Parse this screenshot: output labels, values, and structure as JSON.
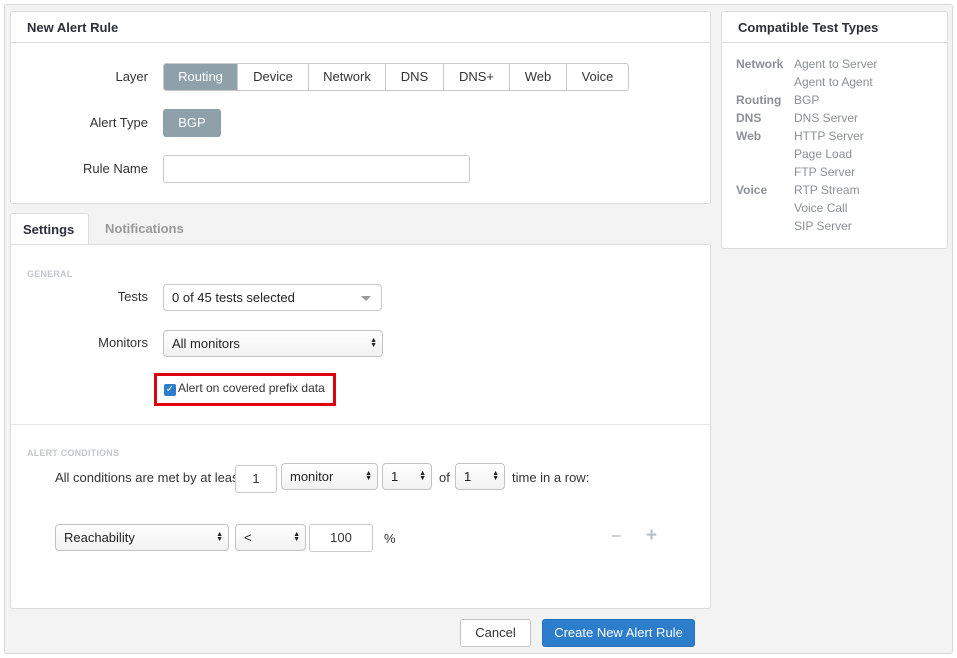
{
  "panel": {
    "title": "New Alert Rule"
  },
  "form": {
    "layer_label": "Layer",
    "layers": [
      "Routing",
      "Device",
      "Network",
      "DNS",
      "DNS+",
      "Web",
      "Voice"
    ],
    "alert_type_label": "Alert Type",
    "alert_type_value": "BGP",
    "rule_name_label": "Rule Name",
    "rule_name_value": ""
  },
  "tabs": {
    "settings": "Settings",
    "notifications": "Notifications"
  },
  "general": {
    "header": "GENERAL",
    "tests_label": "Tests",
    "tests_value": "0 of 45 tests selected",
    "monitors_label": "Monitors",
    "monitors_value": "All monitors",
    "covered_prefix_label": "Alert on covered prefix data",
    "covered_prefix_checked": true
  },
  "conditions": {
    "header": "ALERT CONDITIONS",
    "intro": "All conditions are met by at least",
    "count_value": "1",
    "unit_value": "monitor",
    "times_value": "1",
    "of_text": "of",
    "of_value": "1",
    "row_text": "time in a row:",
    "metric_value": "Reachability",
    "operator_value": "<",
    "threshold_value": "100",
    "unit_suffix": "%",
    "remove_symbol": "−",
    "add_symbol": "+"
  },
  "footer": {
    "cancel_label": "Cancel",
    "create_label": "Create New Alert Rule"
  },
  "compatible": {
    "title": "Compatible Test Types",
    "groups": [
      {
        "category": "Network",
        "items": [
          "Agent to Server",
          "Agent to Agent"
        ]
      },
      {
        "category": "Routing",
        "items": [
          "BGP"
        ]
      },
      {
        "category": "DNS",
        "items": [
          "DNS Server"
        ]
      },
      {
        "category": "Web",
        "items": [
          "HTTP Server",
          "Page Load",
          "FTP Server"
        ]
      },
      {
        "category": "Voice",
        "items": [
          "RTP Stream",
          "Voice Call",
          "SIP Server"
        ]
      }
    ]
  },
  "colors": {
    "accent": "#2c7dcb",
    "segment_active": "#8ea1ab",
    "highlight_box": "#e0000d"
  }
}
